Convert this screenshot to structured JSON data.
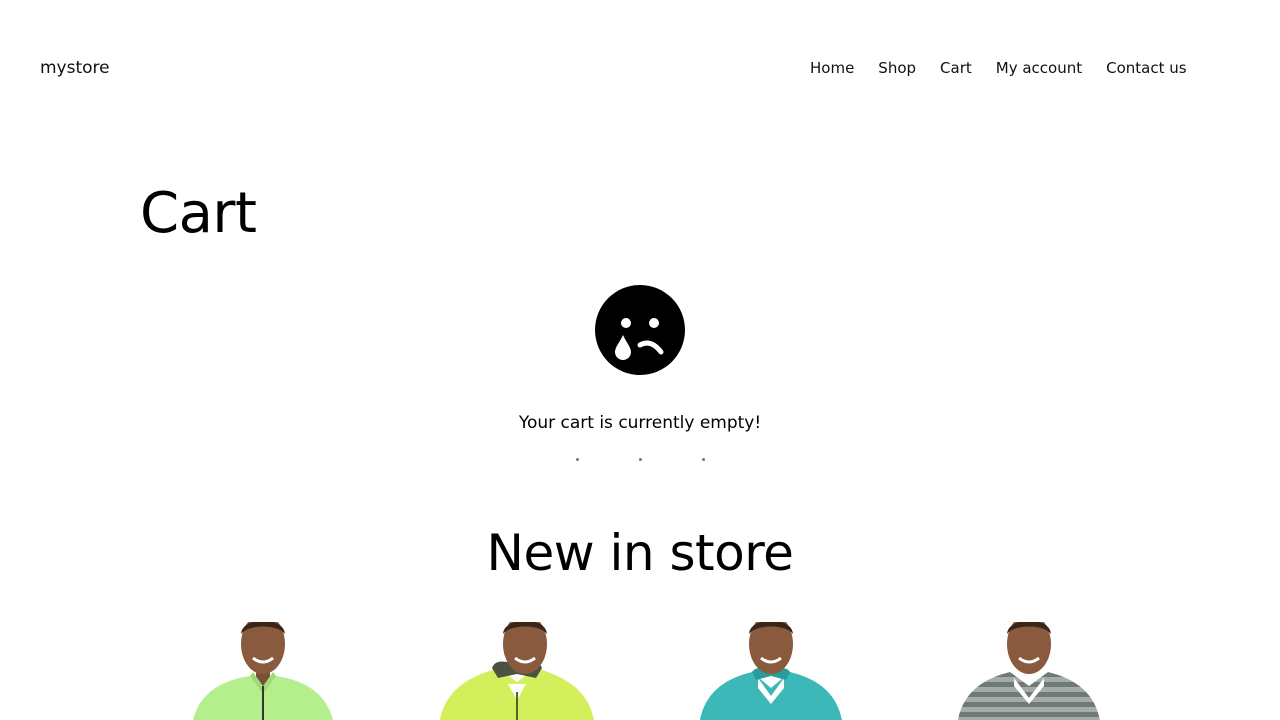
{
  "header": {
    "site_title": "mystore",
    "nav": [
      {
        "label": "Home"
      },
      {
        "label": "Shop"
      },
      {
        "label": "Cart"
      },
      {
        "label": "My account"
      },
      {
        "label": "Contact us"
      }
    ]
  },
  "main": {
    "page_title": "Cart",
    "empty_icon": "sad-face-icon",
    "empty_message": "Your cart is currently empty!",
    "new_in_store_title": "New in store"
  },
  "products": [
    {
      "image": "product-image",
      "color": "#b5ee8c"
    },
    {
      "image": "product-image",
      "color": "#d3ef5c"
    },
    {
      "image": "product-image",
      "color": "#3cb8b8"
    },
    {
      "image": "product-image",
      "color": "#7a8480"
    }
  ]
}
